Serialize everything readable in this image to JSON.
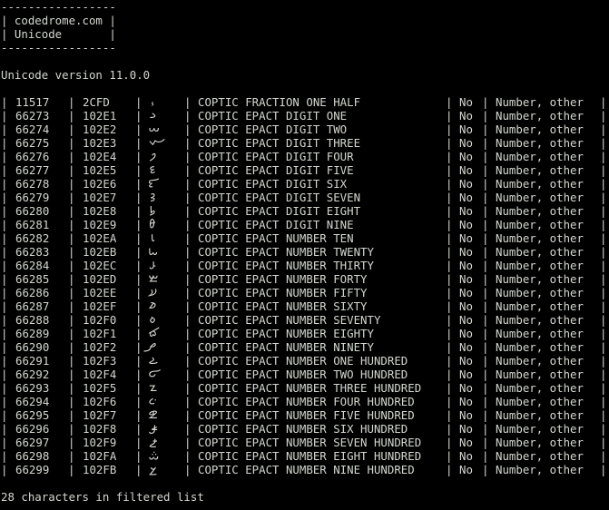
{
  "header": {
    "border_top": "-----------------",
    "line1": "| codedrome.com |",
    "line2": "| Unicode       |",
    "border_bottom": "-----------------"
  },
  "version_text": "Unicode version 11.0.0",
  "separator": "|",
  "rows": [
    {
      "dec": "11517",
      "hex": "2CFD",
      "glyph": "⳽",
      "name": "COPTIC FRACTION ONE HALF",
      "flag": "No",
      "category": "Number, other"
    },
    {
      "dec": "66273",
      "hex": "102E1",
      "glyph": "𐋡",
      "name": "COPTIC EPACT DIGIT ONE",
      "flag": "No",
      "category": "Number, other"
    },
    {
      "dec": "66274",
      "hex": "102E2",
      "glyph": "𐋢",
      "name": "COPTIC EPACT DIGIT TWO",
      "flag": "No",
      "category": "Number, other"
    },
    {
      "dec": "66275",
      "hex": "102E3",
      "glyph": "𐋣",
      "name": "COPTIC EPACT DIGIT THREE",
      "flag": "No",
      "category": "Number, other"
    },
    {
      "dec": "66276",
      "hex": "102E4",
      "glyph": "𐋤",
      "name": "COPTIC EPACT DIGIT FOUR",
      "flag": "No",
      "category": "Number, other"
    },
    {
      "dec": "66277",
      "hex": "102E5",
      "glyph": "𐋥",
      "name": "COPTIC EPACT DIGIT FIVE",
      "flag": "No",
      "category": "Number, other"
    },
    {
      "dec": "66278",
      "hex": "102E6",
      "glyph": "𐋦",
      "name": "COPTIC EPACT DIGIT SIX",
      "flag": "No",
      "category": "Number, other"
    },
    {
      "dec": "66279",
      "hex": "102E7",
      "glyph": "𐋧",
      "name": "COPTIC EPACT DIGIT SEVEN",
      "flag": "No",
      "category": "Number, other"
    },
    {
      "dec": "66280",
      "hex": "102E8",
      "glyph": "𐋨",
      "name": "COPTIC EPACT DIGIT EIGHT",
      "flag": "No",
      "category": "Number, other"
    },
    {
      "dec": "66281",
      "hex": "102E9",
      "glyph": "𐋩",
      "name": "COPTIC EPACT DIGIT NINE",
      "flag": "No",
      "category": "Number, other"
    },
    {
      "dec": "66282",
      "hex": "102EA",
      "glyph": "𐋪",
      "name": "COPTIC EPACT NUMBER TEN",
      "flag": "No",
      "category": "Number, other"
    },
    {
      "dec": "66283",
      "hex": "102EB",
      "glyph": "𐋫",
      "name": "COPTIC EPACT NUMBER TWENTY",
      "flag": "No",
      "category": "Number, other"
    },
    {
      "dec": "66284",
      "hex": "102EC",
      "glyph": "𐋬",
      "name": "COPTIC EPACT NUMBER THIRTY",
      "flag": "No",
      "category": "Number, other"
    },
    {
      "dec": "66285",
      "hex": "102ED",
      "glyph": "𐋭",
      "name": "COPTIC EPACT NUMBER FORTY",
      "flag": "No",
      "category": "Number, other"
    },
    {
      "dec": "66286",
      "hex": "102EE",
      "glyph": "𐋮",
      "name": "COPTIC EPACT NUMBER FIFTY",
      "flag": "No",
      "category": "Number, other"
    },
    {
      "dec": "66287",
      "hex": "102EF",
      "glyph": "𐋯",
      "name": "COPTIC EPACT NUMBER SIXTY",
      "flag": "No",
      "category": "Number, other"
    },
    {
      "dec": "66288",
      "hex": "102F0",
      "glyph": "𐋰",
      "name": "COPTIC EPACT NUMBER SEVENTY",
      "flag": "No",
      "category": "Number, other"
    },
    {
      "dec": "66289",
      "hex": "102F1",
      "glyph": "𐋱",
      "name": "COPTIC EPACT NUMBER EIGHTY",
      "flag": "No",
      "category": "Number, other"
    },
    {
      "dec": "66290",
      "hex": "102F2",
      "glyph": "𐋲",
      "name": "COPTIC EPACT NUMBER NINETY",
      "flag": "No",
      "category": "Number, other"
    },
    {
      "dec": "66291",
      "hex": "102F3",
      "glyph": "𐋳",
      "name": "COPTIC EPACT NUMBER ONE HUNDRED",
      "flag": "No",
      "category": "Number, other"
    },
    {
      "dec": "66292",
      "hex": "102F4",
      "glyph": "𐋴",
      "name": "COPTIC EPACT NUMBER TWO HUNDRED",
      "flag": "No",
      "category": "Number, other"
    },
    {
      "dec": "66293",
      "hex": "102F5",
      "glyph": "𐋵",
      "name": "COPTIC EPACT NUMBER THREE HUNDRED",
      "flag": "No",
      "category": "Number, other"
    },
    {
      "dec": "66294",
      "hex": "102F6",
      "glyph": "𐋶",
      "name": "COPTIC EPACT NUMBER FOUR HUNDRED",
      "flag": "No",
      "category": "Number, other"
    },
    {
      "dec": "66295",
      "hex": "102F7",
      "glyph": "𐋷",
      "name": "COPTIC EPACT NUMBER FIVE HUNDRED",
      "flag": "No",
      "category": "Number, other"
    },
    {
      "dec": "66296",
      "hex": "102F8",
      "glyph": "𐋸",
      "name": "COPTIC EPACT NUMBER SIX HUNDRED",
      "flag": "No",
      "category": "Number, other"
    },
    {
      "dec": "66297",
      "hex": "102F9",
      "glyph": "𐋹",
      "name": "COPTIC EPACT NUMBER SEVEN HUNDRED",
      "flag": "No",
      "category": "Number, other"
    },
    {
      "dec": "66298",
      "hex": "102FA",
      "glyph": "𐋺",
      "name": "COPTIC EPACT NUMBER EIGHT HUNDRED",
      "flag": "No",
      "category": "Number, other"
    },
    {
      "dec": "66299",
      "hex": "102FB",
      "glyph": "𐋻",
      "name": "COPTIC EPACT NUMBER NINE HUNDRED",
      "flag": "No",
      "category": "Number, other"
    }
  ],
  "footer_text": "28 characters in filtered list",
  "colors": {
    "background": "#000000",
    "text": "#d3d7cf"
  }
}
